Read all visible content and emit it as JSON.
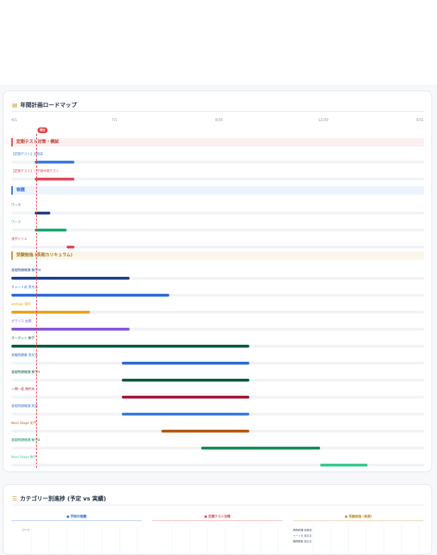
{
  "roadmap": {
    "title": "年間計画ロードマップ",
    "title_icon": "calendar-icon",
    "scale": [
      "4/1",
      "7/1",
      "9/30",
      "12/30",
      "3/31"
    ],
    "today_label": "現在",
    "categories": [
      {
        "key": "exam",
        "label": "定期テスト対策・模試",
        "tasks": [
          {
            "label": "【定期テスト】前期末",
            "color": "#3b7be0",
            "start": 0.057,
            "end": 0.153
          },
          {
            "label": "【定期テスト】一学期中間テスト",
            "color": "#e0485a",
            "start": 0.057,
            "end": 0.153
          }
        ]
      },
      {
        "key": "school",
        "label": "宿題",
        "tasks": [
          {
            "label": "ワーク",
            "color": "#1f3f8a",
            "start": 0.057,
            "end": 0.094
          },
          {
            "label": "ワーク",
            "color": "#1aa86f",
            "start": 0.057,
            "end": 0.134
          },
          {
            "label": "漢字ドリル",
            "color": "#e0485a",
            "start": 0.134,
            "end": 0.153
          }
        ]
      },
      {
        "key": "long",
        "label": "受験勉強 (長期カリキュラム)",
        "tasks": [
          {
            "label": "基礎問題精講 数学IA",
            "color": "#1f3f8a",
            "start": 0.0,
            "end": 0.287
          },
          {
            "label": "チャート式 英文法",
            "color": "#2e6bd6",
            "start": 0.0,
            "end": 0.383
          },
          {
            "label": "stefage 理科",
            "color": "#e8a21c",
            "start": 0.0,
            "end": 0.191
          },
          {
            "label": "ボラリス 古典",
            "color": "#8a55d6",
            "start": 0.0,
            "end": 0.287
          },
          {
            "label": "ターゲット 数学",
            "color": "#0d5a3c",
            "start": 0.0,
            "end": 0.576
          },
          {
            "label": "受験問題集 英文法",
            "color": "#2e6bd6",
            "start": 0.268,
            "end": 0.576
          },
          {
            "label": "基礎問題精講 数学II",
            "color": "#0d5a3c",
            "start": 0.268,
            "end": 0.576
          },
          {
            "label": "一問一答 現代文",
            "color": "#a5173a",
            "start": 0.268,
            "end": 0.576
          },
          {
            "label": "基礎問題精講 英語",
            "color": "#3b7be0",
            "start": 0.268,
            "end": 0.576
          },
          {
            "label": "Next Stage 化学",
            "color": "#b5590f",
            "start": 0.364,
            "end": 0.576
          },
          {
            "label": "基礎問題精講 数学B",
            "color": "#168a5a",
            "start": 0.46,
            "end": 0.748
          },
          {
            "label": "Next Stage 数学",
            "color": "#3cc98f",
            "start": 0.748,
            "end": 0.863
          }
        ]
      }
    ]
  },
  "progress": {
    "title": "カテゴリー別進捗 (予定 vs 実績)",
    "title_icon": "list-icon",
    "charts": [
      {
        "title": "学校の宿題",
        "color": "#2e6bd6",
        "labels": [
          "ワーク"
        ]
      },
      {
        "title": "定期テスト対策",
        "color": "#d9434b",
        "labels": []
      },
      {
        "title": "受験勉強 (長期)",
        "color": "#b88d30",
        "labels": [
          "基礎問題精講 英単語",
          "チャート式 英文法",
          "受験問題集 英文法"
        ]
      }
    ]
  }
}
